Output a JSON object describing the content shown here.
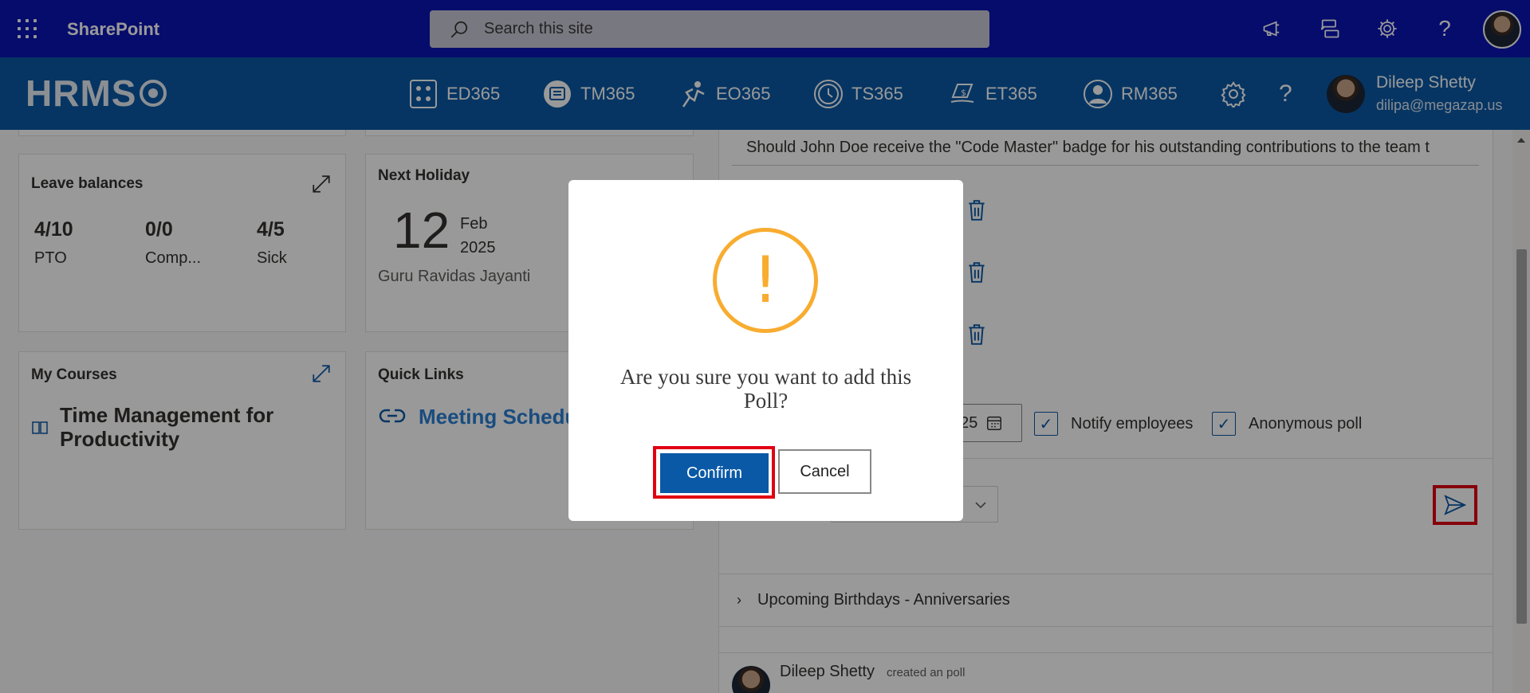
{
  "sharepoint": {
    "brand": "SharePoint",
    "search_placeholder": "Search this site"
  },
  "hrms": {
    "logo": "HRMS",
    "nav": [
      {
        "label": "ED365",
        "icon": "directory-icon"
      },
      {
        "label": "TM365",
        "icon": "training-icon"
      },
      {
        "label": "EO365",
        "icon": "onboarding-icon"
      },
      {
        "label": "TS365",
        "icon": "timesheet-clock-icon"
      },
      {
        "label": "ET365",
        "icon": "expense-icon"
      },
      {
        "label": "RM365",
        "icon": "resource-person-icon"
      }
    ],
    "user": {
      "name": "Dileep Shetty",
      "email": "dilipa@megazap.us"
    }
  },
  "leave_balances": {
    "title": "Leave balances",
    "items": [
      {
        "value": "4/10",
        "label": "PTO"
      },
      {
        "value": "0/0",
        "label": "Comp..."
      },
      {
        "value": "4/5",
        "label": "Sick"
      }
    ]
  },
  "next_holiday": {
    "title": "Next Holiday",
    "day": "12",
    "month": "Feb",
    "year": "2025",
    "name": "Guru Ravidas Jayanti"
  },
  "my_courses": {
    "title": "My Courses",
    "course": "Time Management for Productivity"
  },
  "quick_links": {
    "title": "Quick Links",
    "link": "Meeting Schedu"
  },
  "poll": {
    "question": "Should John Doe receive the \"Code Master\" badge for his outstanding contributions to the team t",
    "date_partial": "025",
    "notify_label": "Notify employees",
    "anonymous_label": "Anonymous poll"
  },
  "birthdays": {
    "label": "Upcoming Birthdays - Anniversaries"
  },
  "feed": {
    "name": "Dileep Shetty",
    "action": "created an poll"
  },
  "dialog": {
    "message": "Are you sure you want to add this Poll?",
    "confirm": "Confirm",
    "cancel": "Cancel",
    "warning_color": "#f8ac30",
    "confirm_color": "#0a59a6",
    "highlight_color": "#e00012"
  }
}
